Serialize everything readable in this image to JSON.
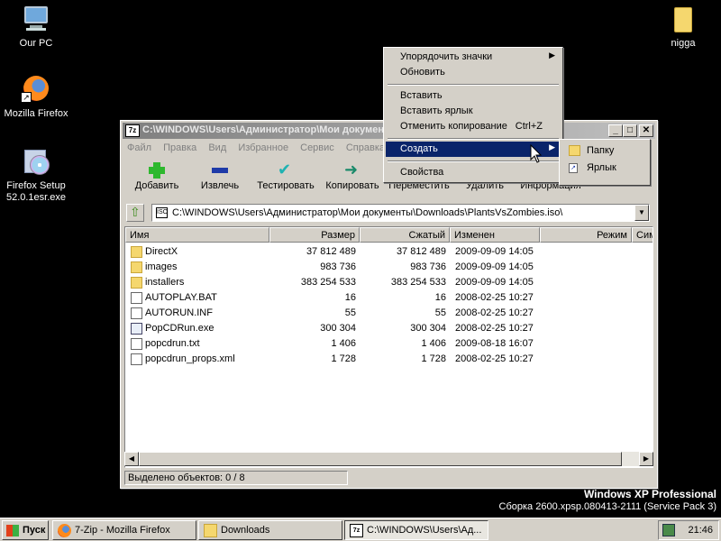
{
  "desktop": {
    "icons": [
      {
        "label": "Our PC"
      },
      {
        "label": "Mozilla Firefox"
      },
      {
        "label_line1": "Firefox Setup",
        "label_line2": "52.0.1esr.exe"
      },
      {
        "label": "nigga"
      }
    ]
  },
  "window": {
    "title": "C:\\WINDOWS\\Users\\Администратор\\Мои документы\\Downloads\\PlantsVsZombies.iso\\",
    "title_icon": "7z",
    "buttons": {
      "minimize": "_",
      "maximize": "□",
      "close": "✕"
    },
    "menu": [
      "Файл",
      "Правка",
      "Вид",
      "Избранное",
      "Сервис",
      "Справка"
    ],
    "toolbar": [
      "Добавить",
      "Извлечь",
      "Тестировать",
      "Копировать",
      "Переместить",
      "Удалить",
      "Информация"
    ],
    "address": "C:\\WINDOWS\\Users\\Администратор\\Мои документы\\Downloads\\PlantsVsZombies.iso\\",
    "address_icon": "ISO",
    "columns": [
      "Имя",
      "Размер",
      "Сжатый",
      "Изменен",
      "Режим",
      "Симв"
    ],
    "files": [
      {
        "name": "DirectX",
        "type": "folder",
        "size": "37 812 489",
        "packed": "37 812 489",
        "modified": "2009-09-09 14:05"
      },
      {
        "name": "images",
        "type": "folder",
        "size": "983 736",
        "packed": "983 736",
        "modified": "2009-09-09 14:05"
      },
      {
        "name": "installers",
        "type": "folder",
        "size": "383 254 533",
        "packed": "383 254 533",
        "modified": "2009-09-09 14:05"
      },
      {
        "name": "AUTOPLAY.BAT",
        "type": "file",
        "size": "16",
        "packed": "16",
        "modified": "2008-02-25 10:27"
      },
      {
        "name": "AUTORUN.INF",
        "type": "file",
        "size": "55",
        "packed": "55",
        "modified": "2008-02-25 10:27"
      },
      {
        "name": "PopCDRun.exe",
        "type": "exe",
        "size": "300 304",
        "packed": "300 304",
        "modified": "2008-02-25 10:27"
      },
      {
        "name": "popcdrun.txt",
        "type": "file",
        "size": "1 406",
        "packed": "1 406",
        "modified": "2009-08-18 16:07"
      },
      {
        "name": "popcdrun_props.xml",
        "type": "file",
        "size": "1 728",
        "packed": "1 728",
        "modified": "2008-02-25 10:27"
      }
    ],
    "status": "Выделено объектов: 0 / 8"
  },
  "context_menu": {
    "items": [
      {
        "label": "Упорядочить значки",
        "submenu": true
      },
      {
        "label": "Обновить"
      },
      {
        "label": "Вставить"
      },
      {
        "label": "Вставить ярлык"
      },
      {
        "label": "Отменить копирование",
        "shortcut": "Ctrl+Z"
      },
      {
        "label": "Создать",
        "submenu": true,
        "selected": true
      },
      {
        "label": "Свойства"
      }
    ],
    "submenu": [
      {
        "label": "Папку",
        "icon": "folder-icon"
      },
      {
        "label": "Ярлык",
        "icon": "shortcut-icon"
      }
    ]
  },
  "watermark": {
    "line1": "Windows XP Professional",
    "line2": "Сборка 2600.xpsp.080413-2111 (Service Pack 3)"
  },
  "taskbar": {
    "start": "Пуск",
    "tasks": [
      {
        "label": "7-Zip - Mozilla Firefox",
        "icon": "firefox-icon"
      },
      {
        "label": "Downloads",
        "icon": "folder-icon"
      },
      {
        "label": "C:\\WINDOWS\\Users\\Ад...",
        "icon": "7zip-icon",
        "active": true
      }
    ],
    "clock": "21:46"
  },
  "colors": {
    "desktop": "#000000",
    "selection": "#0a246a",
    "window_face": "#d4d0c8"
  }
}
